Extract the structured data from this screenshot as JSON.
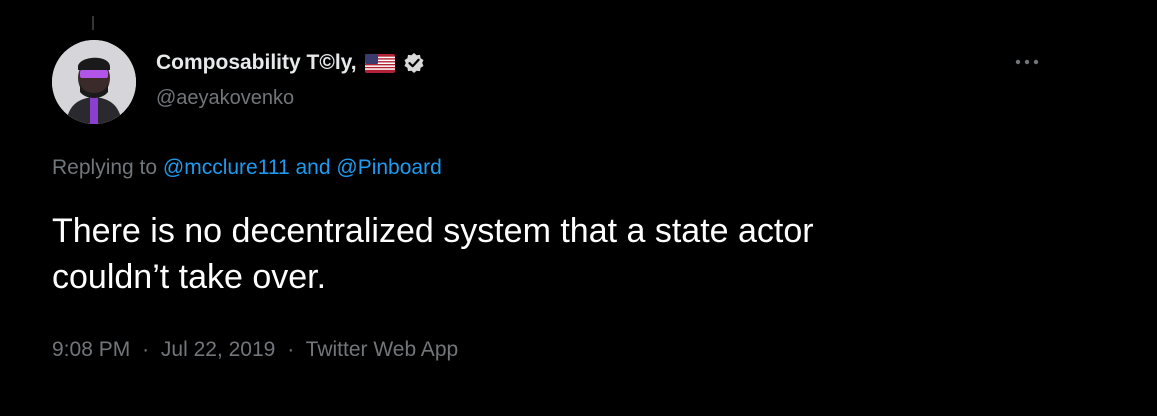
{
  "tweet": {
    "display_name": "Composability T©ly,",
    "handle": "@aeyakovenko",
    "replying_prefix": "Replying to",
    "mention_1": "@mcclure111",
    "replying_and": "and",
    "mention_2": "@Pinboard",
    "text": "There is no decentralized system that a state actor\ncouldn’t take over.",
    "time": "9:08 PM",
    "date": "Jul 22, 2019",
    "source": "Twitter Web App",
    "separator": "·"
  },
  "icons": {
    "flag": "us-flag-icon",
    "verified": "verified-badge-icon",
    "more": "more-options-icon"
  },
  "colors": {
    "background": "#000000",
    "text": "#e7e9ea",
    "secondary": "#71767b",
    "link": "#1d9bf0"
  }
}
